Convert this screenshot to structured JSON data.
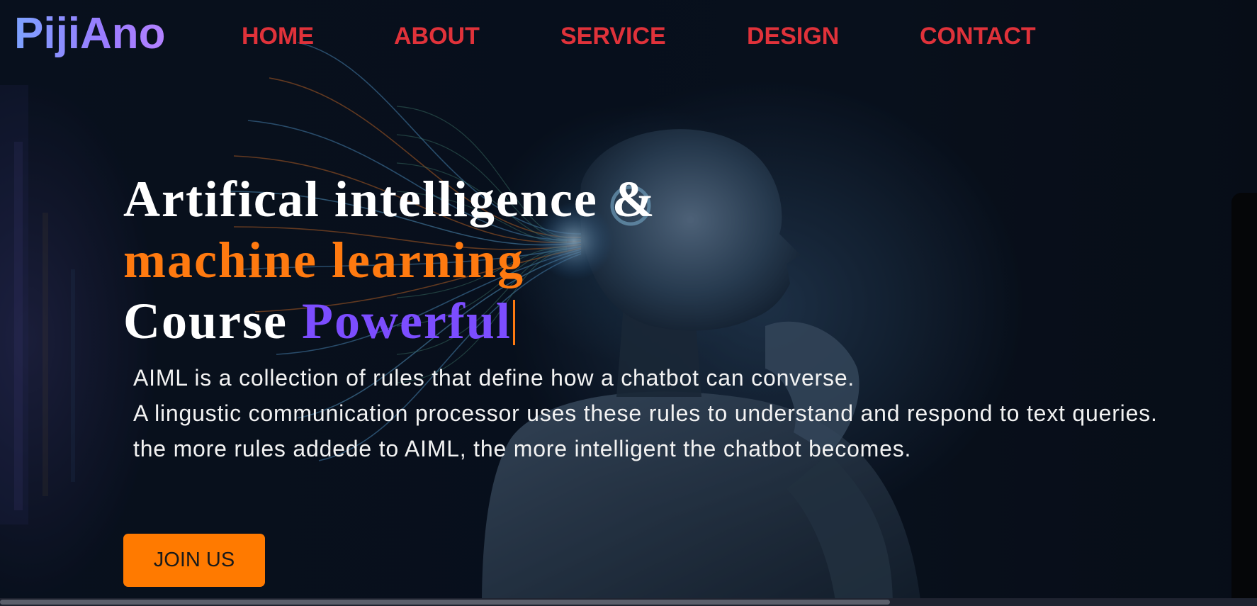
{
  "brand": {
    "logo_text": "PijiAno"
  },
  "nav": {
    "items": [
      {
        "label": "HOME"
      },
      {
        "label": "ABOUT"
      },
      {
        "label": "SERVICE"
      },
      {
        "label": "DESIGN"
      },
      {
        "label": "CONTACT"
      }
    ]
  },
  "hero": {
    "headline_line1": "Artifical intelligence &",
    "headline_line2": "machine learning",
    "headline_line3_prefix": "Course",
    "headline_line3_typed": "Powerful",
    "description": [
      "AIML is a collection of rules that define how a chatbot can converse.",
      "A lingustic communication processor uses these rules to understand and respond to text queries.",
      "the more rules addede to AIML, the more intelligent the chatbot becomes."
    ],
    "cta_label": "JOIN US"
  },
  "colors": {
    "brand_gradient_start": "#7da2ff",
    "brand_gradient_end": "#b382ff",
    "nav_text": "#e0323a",
    "accent_orange": "#ff7a00",
    "accent_purple": "#7c4dff",
    "headline_white": "#ffffff"
  }
}
